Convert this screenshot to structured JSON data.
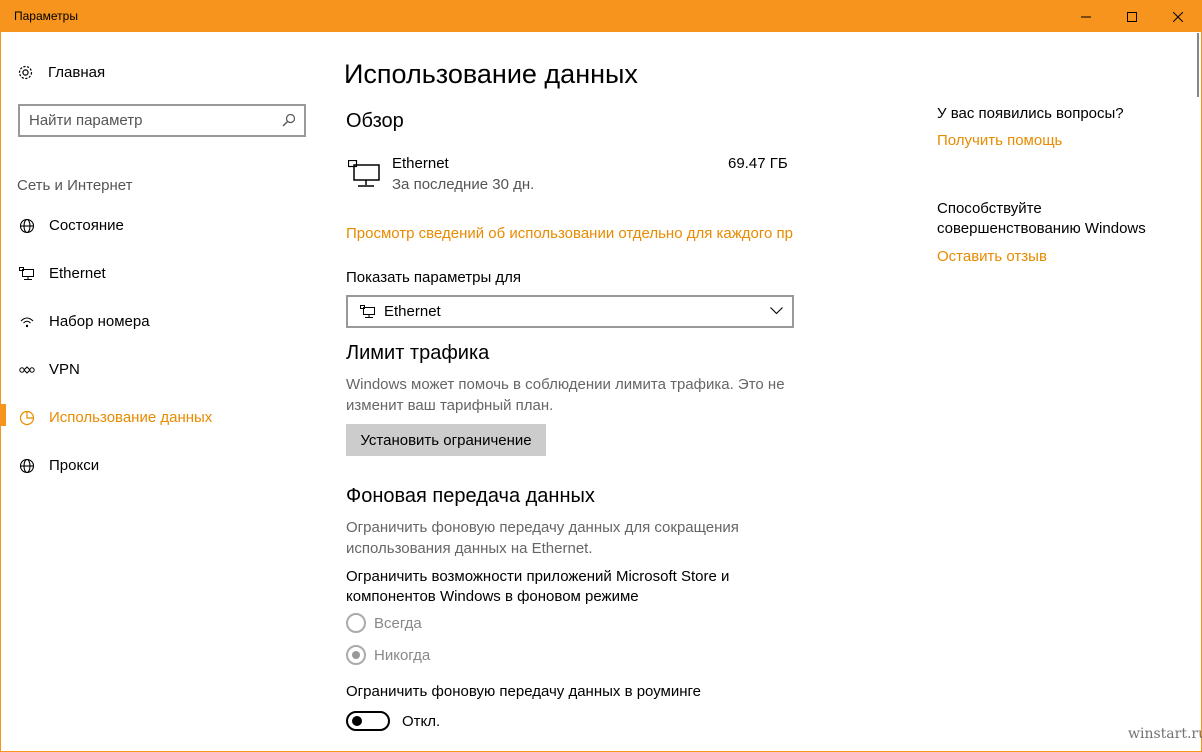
{
  "window": {
    "title": "Параметры",
    "accent": "#f7941d"
  },
  "sidebar": {
    "home_label": "Главная",
    "search_placeholder": "Найти параметр",
    "section_label": "Сеть и Интернет",
    "items": [
      {
        "label": "Состояние",
        "icon": "globe-status-icon"
      },
      {
        "label": "Ethernet",
        "icon": "ethernet-icon"
      },
      {
        "label": "Набор номера",
        "icon": "dialup-icon"
      },
      {
        "label": "VPN",
        "icon": "vpn-icon"
      },
      {
        "label": "Использование данных",
        "icon": "data-usage-icon",
        "active": true
      },
      {
        "label": "Прокси",
        "icon": "globe-proxy-icon"
      }
    ]
  },
  "main": {
    "title": "Использование данных",
    "overview_heading": "Обзор",
    "usage": {
      "name": "Ethernet",
      "period": "За последние 30 дн.",
      "amount": "69.47 ГБ"
    },
    "details_link": "Просмотр сведений об использовании отдельно для каждого пр",
    "show_for_label": "Показать параметры для",
    "show_for_value": "Ethernet",
    "limit_heading": "Лимит трафика",
    "limit_desc": "Windows может помочь в соблюдении лимита трафика. Это не изменит ваш тарифный план.",
    "limit_button": "Установить ограничение",
    "bg_heading": "Фоновая передача данных",
    "bg_desc": "Ограничить фоновую передачу данных для сокращения использования данных на Ethernet.",
    "bg_store_label": "Ограничить возможности приложений Microsoft Store и компонентов Windows в фоновом режиме",
    "radio_always": "Всегда",
    "radio_never": "Никогда",
    "roaming_label": "Ограничить фоновую передачу данных в роуминге",
    "toggle_state": "Откл."
  },
  "right": {
    "questions": "У вас появились вопросы?",
    "help_link": "Получить помощь",
    "improve": "Способствуйте совершенствованию Windows",
    "feedback_link": "Оставить отзыв"
  },
  "watermark": "winstart.ru"
}
